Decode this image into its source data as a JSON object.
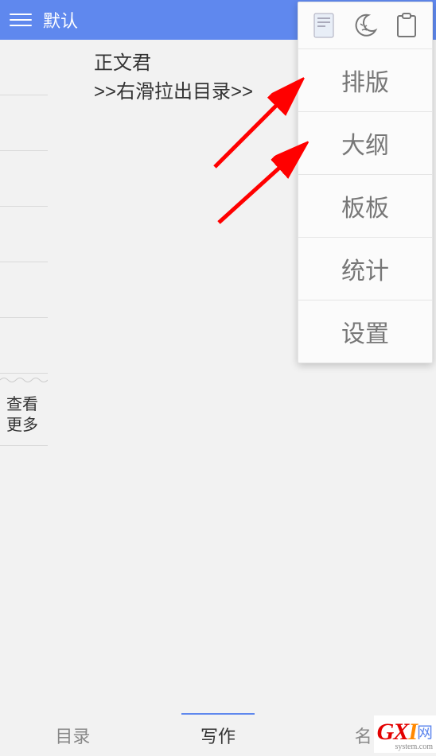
{
  "header": {
    "title": "默认"
  },
  "content": {
    "line1": "正文君",
    "line2": ">>右滑拉出目录>>"
  },
  "leftRail": {
    "viewMore": "查看更多"
  },
  "dropdown": {
    "items": [
      "排版",
      "大纲",
      "板板",
      "统计",
      "设置"
    ]
  },
  "bottomNav": {
    "tab1": "目录",
    "tab2": "写作",
    "tab3": "名"
  },
  "watermark": {
    "brand": "GXI",
    "text": "网",
    "sub": "system.com"
  }
}
